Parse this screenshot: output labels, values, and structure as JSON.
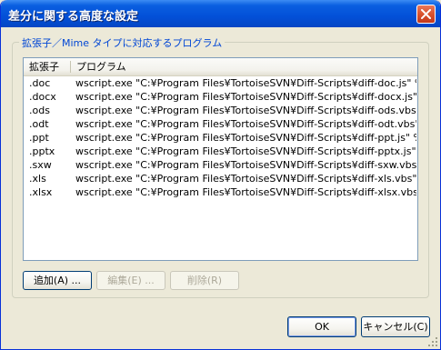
{
  "window": {
    "title": "差分に関する高度な設定"
  },
  "group": {
    "label": "拡張子／Mime タイプに対応するプログラム"
  },
  "list": {
    "columns": [
      "拡張子",
      "プログラム"
    ],
    "rows": [
      {
        "ext": ".doc",
        "program": "wscript.exe \"C:¥Program Files¥TortoiseSVN¥Diff-Scripts¥diff-doc.js\" %bas..."
      },
      {
        "ext": ".docx",
        "program": "wscript.exe \"C:¥Program Files¥TortoiseSVN¥Diff-Scripts¥diff-docx.js\" %ba..."
      },
      {
        "ext": ".ods",
        "program": "wscript.exe \"C:¥Program Files¥TortoiseSVN¥Diff-Scripts¥diff-ods.vbs\" %ba..."
      },
      {
        "ext": ".odt",
        "program": "wscript.exe \"C:¥Program Files¥TortoiseSVN¥Diff-Scripts¥diff-odt.vbs\" %b..."
      },
      {
        "ext": ".ppt",
        "program": "wscript.exe \"C:¥Program Files¥TortoiseSVN¥Diff-Scripts¥diff-ppt.js\" %bas..."
      },
      {
        "ext": ".pptx",
        "program": "wscript.exe \"C:¥Program Files¥TortoiseSVN¥Diff-Scripts¥diff-pptx.js\" %ba..."
      },
      {
        "ext": ".sxw",
        "program": "wscript.exe \"C:¥Program Files¥TortoiseSVN¥Diff-Scripts¥diff-sxw.vbs\" %ba..."
      },
      {
        "ext": ".xls",
        "program": "wscript.exe \"C:¥Program Files¥TortoiseSVN¥Diff-Scripts¥diff-xls.vbs\" %ba..."
      },
      {
        "ext": ".xlsx",
        "program": "wscript.exe \"C:¥Program Files¥TortoiseSVN¥Diff-Scripts¥diff-xlsx.vbs\" %b..."
      }
    ]
  },
  "buttons": {
    "add": "追加(A) ...",
    "edit": "編集(E) ...",
    "remove": "削除(R)",
    "ok": "OK",
    "cancel": "キャンセル(C)"
  },
  "icons": {
    "close": "close-icon",
    "sizegrip": "size-grip-icon"
  },
  "colors": {
    "titlebar": "#0a5fe0",
    "group_label": "#0046d5",
    "close_button": "#d9532e",
    "dialog_bg": "#ece9d8"
  }
}
